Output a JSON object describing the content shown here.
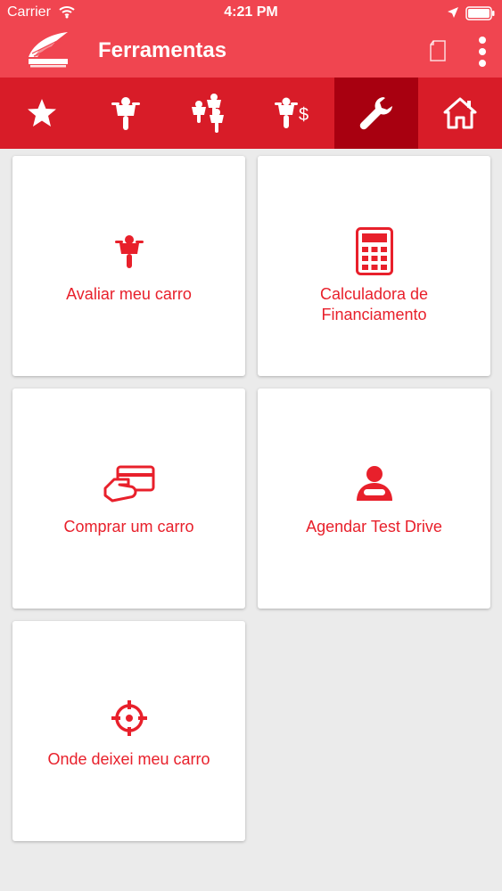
{
  "status_bar": {
    "carrier": "Carrier",
    "time": "4:21 PM"
  },
  "app_bar": {
    "title": "Ferramentas",
    "background_color": "#f04550"
  },
  "tabs": [
    {
      "icon": "star-icon",
      "active": false
    },
    {
      "icon": "motorcycle-icon",
      "active": false
    },
    {
      "icon": "multiple-motorcycles-icon",
      "active": false
    },
    {
      "icon": "motorcycle-price-icon",
      "active": false
    },
    {
      "icon": "wrench-icon",
      "active": true
    },
    {
      "icon": "home-icon",
      "active": false
    }
  ],
  "tab_colors": {
    "bar": "#d81c28",
    "active": "#a80010"
  },
  "cards": [
    {
      "icon": "motorcycle-icon",
      "label": "Avaliar meu carro"
    },
    {
      "icon": "calculator-icon",
      "label_line1": "Calculadora de",
      "label_line2": "Financiamento"
    },
    {
      "icon": "payment-card-icon",
      "label": "Comprar um carro"
    },
    {
      "icon": "driver-icon",
      "label": "Agendar Test Drive"
    },
    {
      "icon": "target-icon",
      "label": "Onde deixei meu carro"
    }
  ],
  "accent_color": "#e8202b"
}
